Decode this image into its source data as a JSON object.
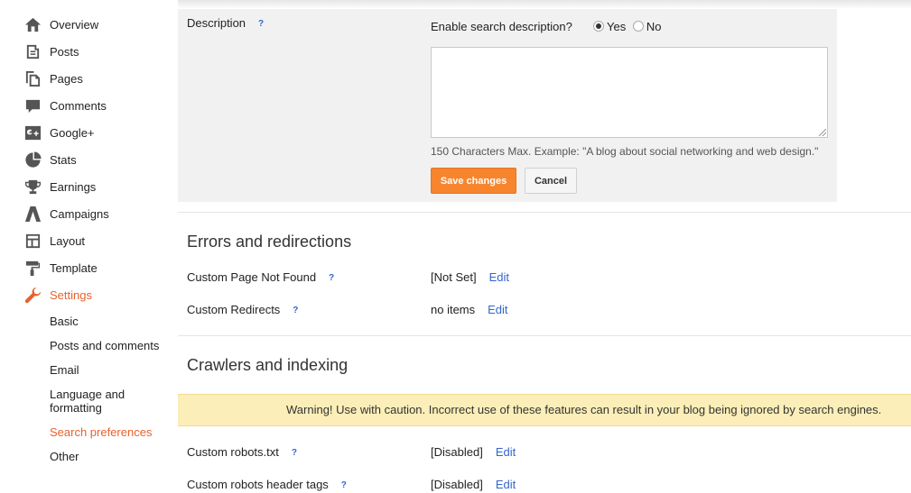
{
  "sidebar": {
    "items": [
      {
        "label": "Overview",
        "icon": "home-icon"
      },
      {
        "label": "Posts",
        "icon": "posts-icon"
      },
      {
        "label": "Pages",
        "icon": "pages-icon"
      },
      {
        "label": "Comments",
        "icon": "comment-icon"
      },
      {
        "label": "Google+",
        "icon": "google-plus-icon"
      },
      {
        "label": "Stats",
        "icon": "pie-chart-icon"
      },
      {
        "label": "Earnings",
        "icon": "trophy-icon"
      },
      {
        "label": "Campaigns",
        "icon": "campaigns-icon"
      },
      {
        "label": "Layout",
        "icon": "layout-icon"
      },
      {
        "label": "Template",
        "icon": "paint-roller-icon"
      },
      {
        "label": "Settings",
        "icon": "wrench-icon"
      }
    ],
    "settings_sub": [
      "Basic",
      "Posts and comments",
      "Email",
      "Language and formatting",
      "Search preferences",
      "Other"
    ]
  },
  "description": {
    "label": "Description",
    "help": "?",
    "enable_question": "Enable search description?",
    "yes": "Yes",
    "no": "No",
    "hint": "150 Characters Max. Example: \"A blog about social networking and web design.\"",
    "save": "Save changes",
    "cancel": "Cancel"
  },
  "errors": {
    "title": "Errors and redirections",
    "rows": [
      {
        "label": "Custom Page Not Found",
        "value": "[Not Set]",
        "edit": "Edit"
      },
      {
        "label": "Custom Redirects",
        "value": "no items",
        "edit": "Edit"
      }
    ]
  },
  "crawlers": {
    "title": "Crawlers and indexing",
    "warning": "Warning! Use with caution. Incorrect use of these features can result in your blog being ignored by search engines.",
    "rows": [
      {
        "label": "Custom robots.txt",
        "value": "[Disabled]",
        "edit": "Edit"
      },
      {
        "label": "Custom robots header tags",
        "value": "[Disabled]",
        "edit": "Edit"
      }
    ]
  },
  "colors": {
    "accent": "#e8612c",
    "save_button": "#f7852e",
    "link": "#3366cc",
    "warning_bg": "#fbeeb8"
  }
}
